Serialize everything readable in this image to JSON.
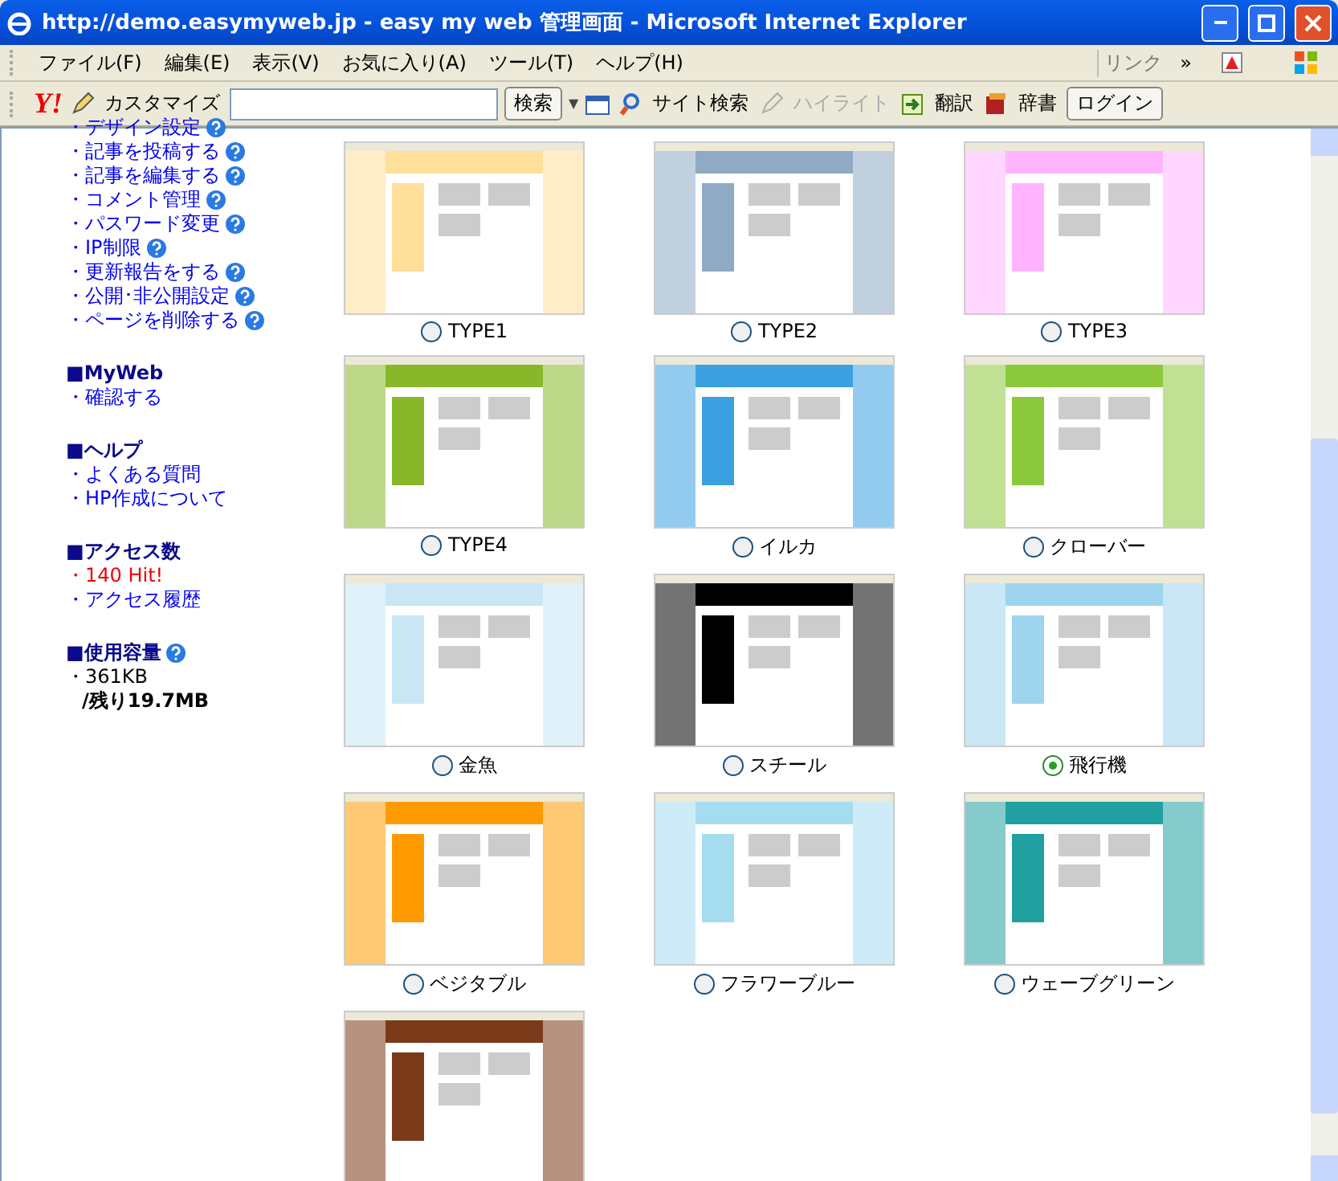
{
  "window": {
    "title": "http://demo.easymyweb.jp - easy my web 管理画面 - Microsoft Internet Explorer"
  },
  "menu": [
    "ファイル(F)",
    "編集(E)",
    "表示(V)",
    "お気に入り(A)",
    "ツール(T)",
    "ヘルプ(H)"
  ],
  "links_label": "リンク",
  "links_more": "»",
  "toolbar": {
    "logo": "Y!",
    "customize": "カスタマイズ",
    "search_button": "検索",
    "dropdown_caret": "▼",
    "site_search": "サイト検索",
    "highlight": {
      "label": "ハイライト",
      "disabled": true
    },
    "translate": "翻訳",
    "dictionary": "辞書",
    "login": "ログイン"
  },
  "sidebar": [
    {
      "items": [
        {
          "text": "・デザイン設定",
          "kind": "link",
          "help": true
        },
        {
          "text": "・記事を投稿する",
          "kind": "link",
          "help": true
        },
        {
          "text": "・記事を編集する",
          "kind": "link",
          "help": true
        },
        {
          "text": "・コメント管理",
          "kind": "link",
          "help": true
        },
        {
          "text": "・パスワード変更",
          "kind": "link",
          "help": true
        },
        {
          "text": "・IP制限",
          "kind": "link",
          "help": true
        },
        {
          "text": "・更新報告をする",
          "kind": "link",
          "help": true
        },
        {
          "text": "・公開･非公開設定",
          "kind": "link",
          "help": true
        },
        {
          "text": "・ページを削除する",
          "kind": "link",
          "help": true
        }
      ]
    },
    {
      "heading": "■MyWeb",
      "help": false,
      "items": [
        {
          "text": "・確認する",
          "kind": "link",
          "help": false
        }
      ]
    },
    {
      "heading": "■ヘルプ",
      "help": false,
      "items": [
        {
          "text": "・よくある質問",
          "kind": "link",
          "help": false
        },
        {
          "text": "・HP作成について",
          "kind": "link",
          "help": false
        }
      ]
    },
    {
      "heading": "■アクセス数",
      "help": false,
      "items": [
        {
          "text": "・140 Hit!",
          "kind": "count",
          "help": false
        },
        {
          "text": "・アクセス履歴",
          "kind": "link",
          "help": false
        }
      ]
    },
    {
      "heading": "■使用容量",
      "help": true,
      "items": [
        {
          "text": "・361KB",
          "kind": "plain",
          "help": false
        },
        {
          "text": "/残り19.7MB",
          "kind": "total",
          "help": false
        }
      ]
    }
  ],
  "themes": [
    {
      "label": "TYPE1",
      "selected": false,
      "color": "#ffdf9a"
    },
    {
      "label": "TYPE2",
      "selected": false,
      "color": "#8eaac4"
    },
    {
      "label": "TYPE3",
      "selected": false,
      "color": "#ffb4ff"
    },
    {
      "label": "TYPE4",
      "selected": false,
      "color": "#88b82a"
    },
    {
      "label": "イルカ",
      "selected": false,
      "color": "#3aa0e0"
    },
    {
      "label": "クローバー",
      "selected": false,
      "color": "#8cc83c"
    },
    {
      "label": "金魚",
      "selected": false,
      "color": "#c8e6f4"
    },
    {
      "label": "スチール",
      "selected": false,
      "color": "#000000"
    },
    {
      "label": "飛行機",
      "selected": true,
      "color": "#9ed4ee"
    },
    {
      "label": "ベジタブル",
      "selected": false,
      "color": "#ff9a00"
    },
    {
      "label": "フラワーブルー",
      "selected": false,
      "color": "#a6dcf0"
    },
    {
      "label": "ウェーブグリーン",
      "selected": false,
      "color": "#20a0a0"
    },
    {
      "color": "#7a3a1a"
    }
  ]
}
